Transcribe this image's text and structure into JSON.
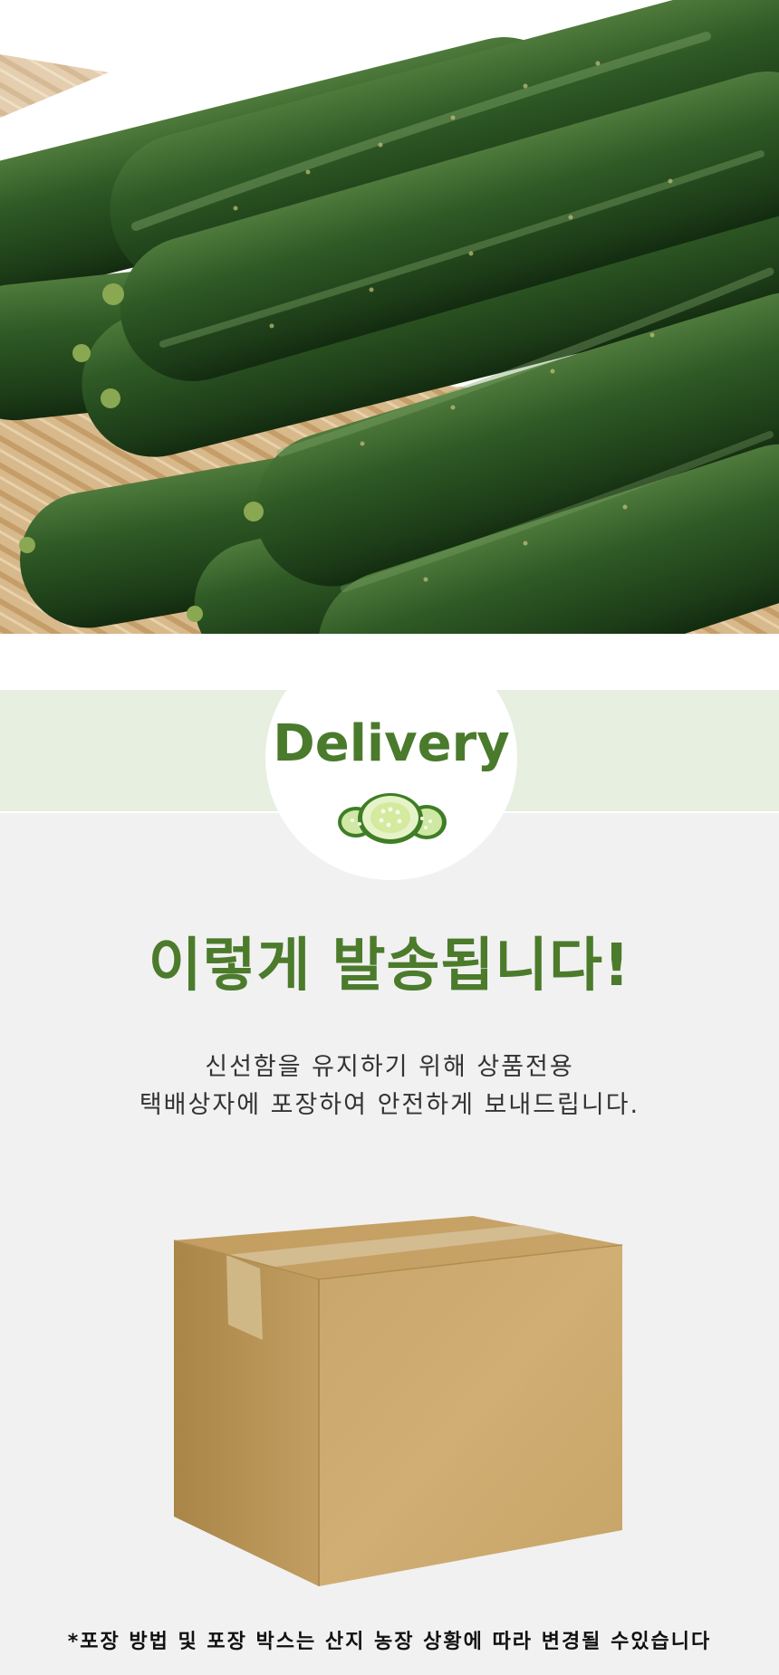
{
  "hero": {
    "image_subject": "cucumbers-on-bamboo-tray",
    "colors": {
      "cucumber_dark": "#1d3d18",
      "cucumber_mid": "#2f5a25",
      "cucumber_light": "#4f7a3c",
      "tray": "#d8b98c"
    }
  },
  "delivery_section": {
    "badge_title": "Delivery",
    "badge_icon": "cucumber-slices-icon",
    "headline": "이렇게 발송됩니다!",
    "description_line1": "신선함을 유지하기 위해 상품전용",
    "description_line2": "택배상자에 포장하여 안전하게 보내드립니다.",
    "box_image": "cardboard-box-icon",
    "footnote": "*포장 방법 및 포장 박스는 산지 농장 상황에 따라 변경될 수있습니다"
  },
  "colors": {
    "accent_green": "#4b7b2b",
    "band_green": "#e6efe0",
    "page_background": "#f1f1f1",
    "box_tan": "#c9a66b"
  }
}
